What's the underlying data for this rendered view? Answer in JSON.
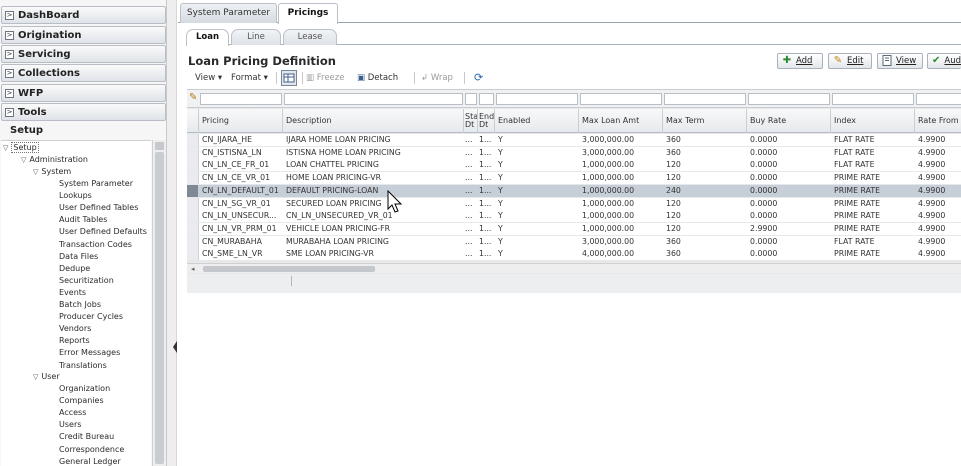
{
  "sidebar": {
    "accordion": [
      {
        "label": "DashBoard",
        "toggle": ">"
      },
      {
        "label": "Origination",
        "toggle": ">"
      },
      {
        "label": "Servicing",
        "toggle": ">"
      },
      {
        "label": "Collections",
        "toggle": ">"
      },
      {
        "label": "WFP",
        "toggle": ">"
      },
      {
        "label": "Tools",
        "toggle": ">"
      }
    ],
    "setup_title": "Setup",
    "tree": {
      "root": "Setup",
      "administration": "Administration",
      "system": "System",
      "system_items": [
        "System Parameter",
        "Lookups",
        "User Defined Tables",
        "Audit Tables",
        "User Defined Defaults",
        "Transaction Codes",
        "Data Files",
        "Dedupe",
        "Securitization",
        "Events",
        "Batch Jobs",
        "Producer Cycles",
        "Vendors",
        "Reports",
        "Error Messages",
        "Translations"
      ],
      "user": "User",
      "user_items": [
        "Organization",
        "Companies",
        "Access",
        "Users",
        "Credit Bureau",
        "Correspondence",
        "General Ledger"
      ],
      "expand_glyph": "▽"
    }
  },
  "main": {
    "top_tabs": [
      {
        "label": "System Parameter",
        "active": false
      },
      {
        "label": "Pricings",
        "active": true
      }
    ],
    "sub_tabs": [
      {
        "label": "Loan",
        "active": true
      },
      {
        "label": "Line",
        "active": false
      },
      {
        "label": "Lease",
        "active": false
      }
    ],
    "page_title": "Loan Pricing Definition",
    "actions": {
      "add": "Add",
      "edit": "Edit",
      "view": "View",
      "audit": "Aud"
    },
    "toolbar": {
      "view": "View ▾",
      "format": "Format ▾",
      "freeze": "Freeze",
      "detach": "Detach",
      "wrap": "Wrap"
    }
  },
  "table": {
    "columns": [
      "Pricing",
      "Description",
      "Sta Dt",
      "End Dt",
      "Enabled",
      "Max Loan Amt",
      "Max Term",
      "Buy Rate",
      "Index",
      "Rate From"
    ],
    "rows": [
      [
        "CN_IJARA_HE",
        "IJARA HOME LOAN PRICING",
        "...",
        "1...",
        "Y",
        "3,000,000.00",
        "360",
        "0.0000",
        "FLAT RATE",
        "4.9900"
      ],
      [
        "CN_ISTISNA_LN",
        "ISTISNA HOME LOAN PRICING",
        "...",
        "1...",
        "Y",
        "3,000,000.00",
        "360",
        "0.0000",
        "FLAT RATE",
        "4.9900"
      ],
      [
        "CN_LN_CE_FR_01",
        "LOAN CHATTEL PRICING",
        "...",
        "1...",
        "Y",
        "1,000,000.00",
        "120",
        "0.0000",
        "FLAT RATE",
        "4.9900"
      ],
      [
        "CN_LN_CE_VR_01",
        "HOME LOAN PRICING-VR",
        "...",
        "1...",
        "Y",
        "1,000,000.00",
        "120",
        "0.0000",
        "PRIME RATE",
        "4.9900"
      ],
      [
        "CN_LN_DEFAULT_01",
        "DEFAULT PRICING-LOAN",
        "...",
        "1...",
        "Y",
        "1,000,000.00",
        "240",
        "0.0000",
        "PRIME RATE",
        "4.9900"
      ],
      [
        "CN_LN_SG_VR_01",
        "SECURED LOAN PRICING",
        "...",
        "1...",
        "Y",
        "1,000,000.00",
        "120",
        "0.0000",
        "PRIME RATE",
        "4.9900"
      ],
      [
        "CN_LN_UNSECUR...",
        "CN_LN_UNSECURED_VR_01",
        "...",
        "1...",
        "Y",
        "1,000,000.00",
        "120",
        "0.0000",
        "PRIME RATE",
        "4.9900"
      ],
      [
        "CN_LN_VR_PRM_01",
        "VEHICLE LOAN PRICING-FR",
        "...",
        "1...",
        "Y",
        "1,000,000.00",
        "120",
        "2.9900",
        "PRIME RATE",
        "4.9900"
      ],
      [
        "CN_MURABAHA",
        "MURABAHA LOAN PRICING",
        "...",
        "1...",
        "Y",
        "3,000,000.00",
        "360",
        "0.0000",
        "FLAT RATE",
        "4.9900"
      ],
      [
        "CN_SME_LN_VR",
        "SME LOAN PRICING-VR",
        "...",
        "1...",
        "Y",
        "4,000,000.00",
        "360",
        "0.0000",
        "PRIME RATE",
        "4.9900"
      ]
    ],
    "selected_row_index": 4
  },
  "colors": {
    "selected_row": "#c6cfd8",
    "add_icon": "#2e8b2e",
    "edit_icon": "#c08a10",
    "audit_icon": "#2e8b2e"
  }
}
